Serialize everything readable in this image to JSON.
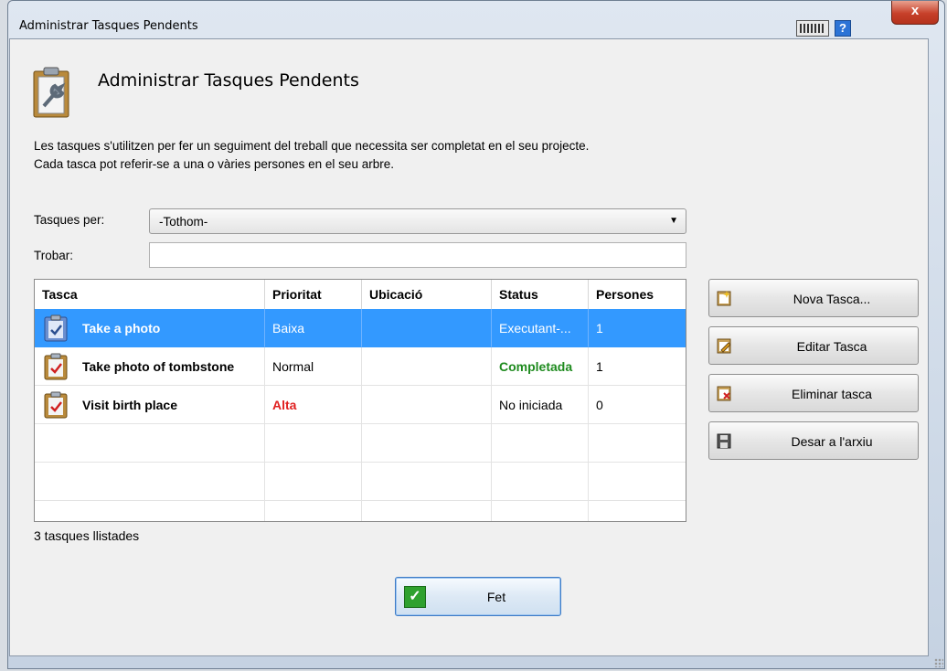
{
  "window": {
    "title": "Administrar Tasques Pendents",
    "close_label": "x",
    "help_label": "?"
  },
  "header": {
    "title": "Administrar Tasques Pendents",
    "description_line1": "Les tasques s'utilitzen per fer un seguiment del treball que necessita ser completat en el seu projecte.",
    "description_line2": "Cada tasca pot referir-se a una o vàries persones en el seu arbre."
  },
  "filters": {
    "tasks_by_label": "Tasques per:",
    "tasks_by_value": "-Tothom-",
    "find_label": "Trobar:",
    "find_value": ""
  },
  "table": {
    "columns": [
      "Tasca",
      "Prioritat",
      "Ubicació",
      "Status",
      "Persones"
    ],
    "rows": [
      {
        "task": "Take a photo",
        "priority": "Baixa",
        "location": "",
        "status": "Executant-...",
        "persons": "1",
        "selected": true
      },
      {
        "task": "Take photo of tombstone",
        "priority": "Normal",
        "location": "",
        "status": "Completada",
        "persons": "1",
        "selected": false
      },
      {
        "task": "Visit birth place",
        "priority": "Alta",
        "location": "",
        "status": "No iniciada",
        "persons": "0",
        "selected": false
      }
    ],
    "count_label": "3 tasques llistades"
  },
  "actions": {
    "new_task": "Nova Tasca...",
    "edit_task": "Editar Tasca",
    "delete_task": "Eliminar tasca",
    "save_to_file": "Desar a l'arxiu",
    "done": "Fet"
  },
  "colors": {
    "selection": "#3399ff",
    "completed": "#1f8b1f",
    "high_priority": "#e02020"
  }
}
